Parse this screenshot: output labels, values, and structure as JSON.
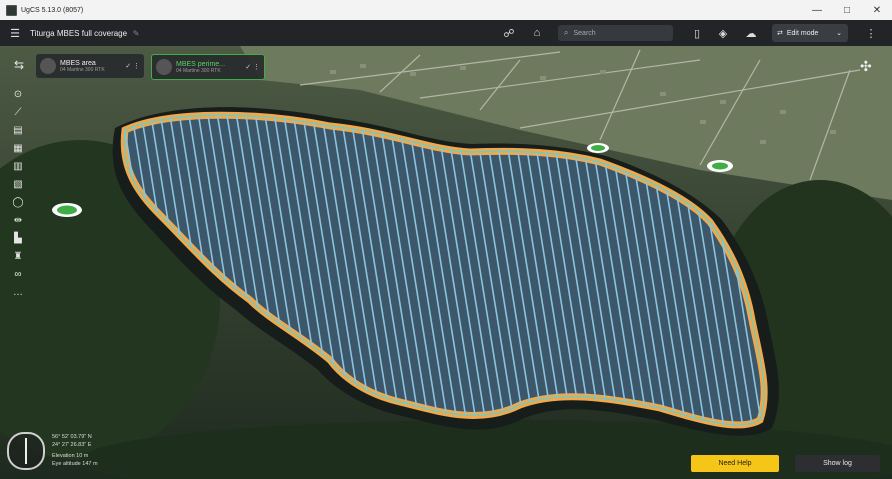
{
  "window": {
    "title": "UgCS 5.13.0 (8057)",
    "minimize": "—",
    "maximize": "□",
    "close": "✕"
  },
  "toolbar": {
    "mission_title": "Titurga MBES full coverage",
    "search_placeholder": "Search",
    "edit_mode_label": "Edit mode"
  },
  "chips": [
    {
      "title": "MBES area",
      "subtitle": "04 Martine 300 RTK"
    },
    {
      "title": "MBES perime...",
      "subtitle": "04 Martine 300 RTK"
    }
  ],
  "map": {
    "coords_lat": "56° 52' 03.79\" N",
    "coords_lon": "24° 27' 26.83\" E",
    "elevation": "Elevation 10 m",
    "eye_altitude": "Eye altitude 147 m"
  },
  "buttons": {
    "need_help": "Need Help",
    "show_log": "Show log"
  },
  "colors": {
    "accent_help": "#f5c518",
    "route": "#7fb8d6",
    "perimeter": "#f0a84a",
    "selected_chip": "#3fae46"
  }
}
